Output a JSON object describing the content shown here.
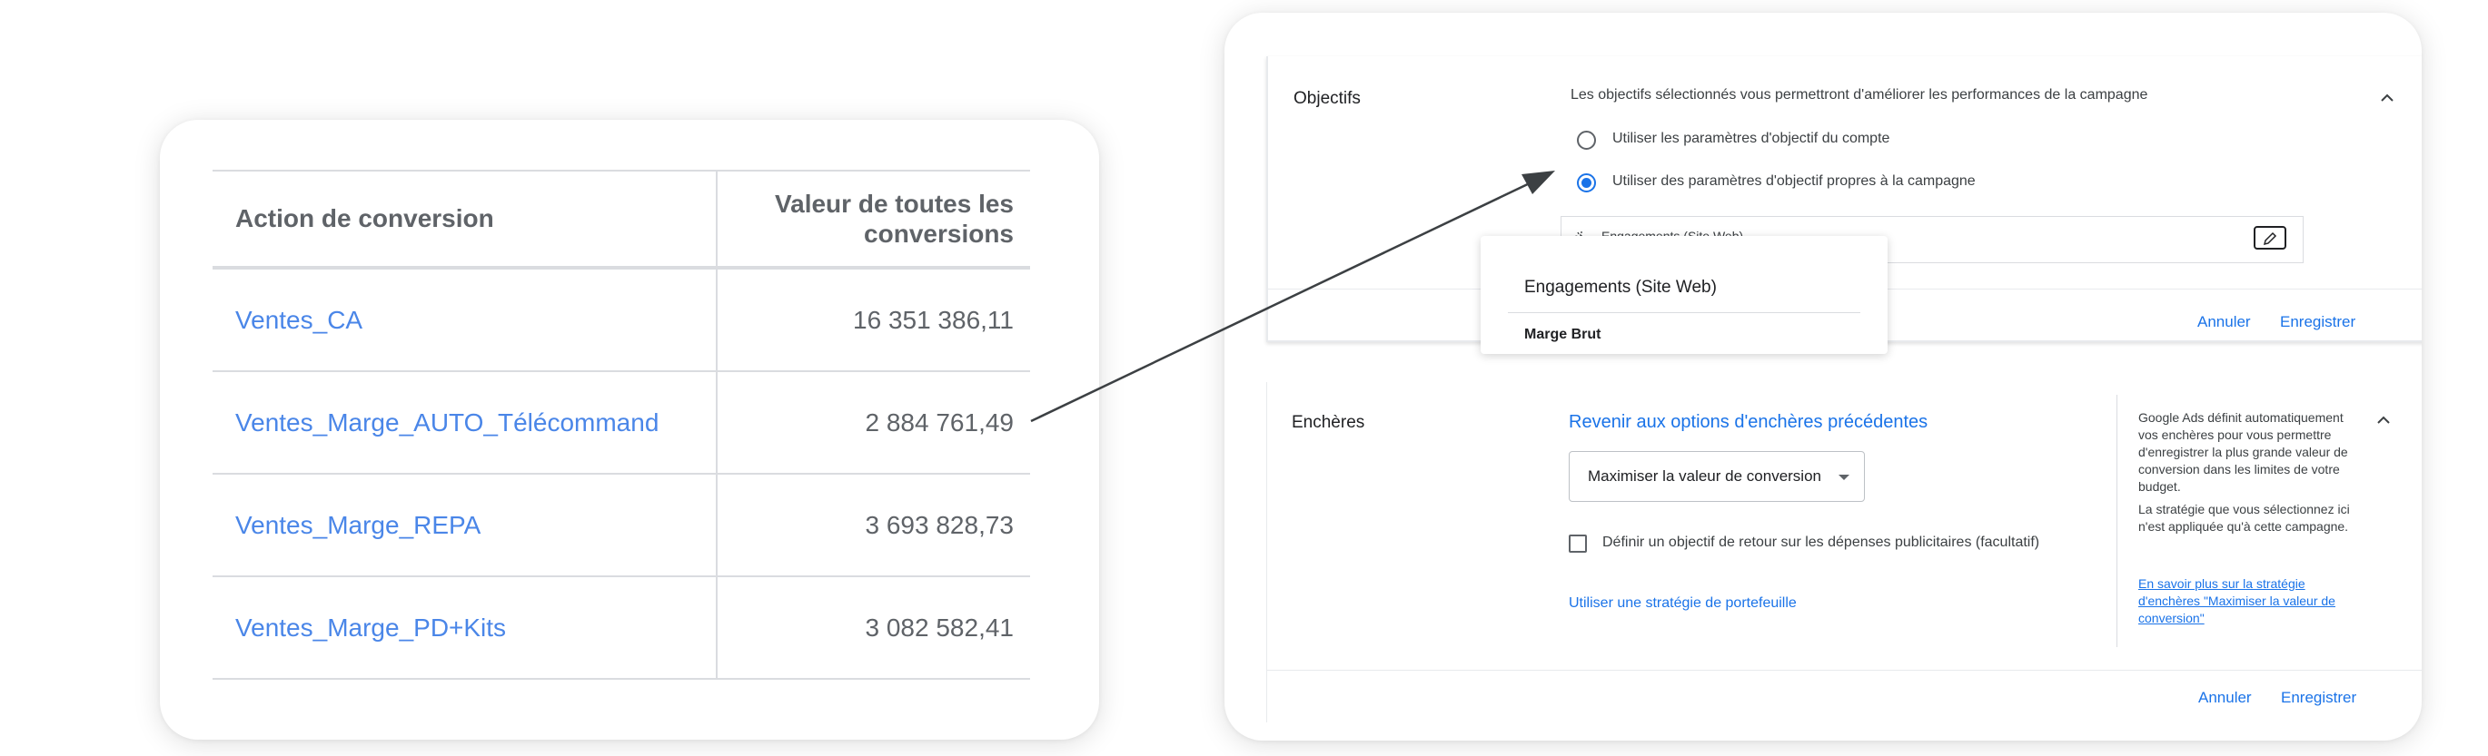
{
  "conversion_table": {
    "header_action": "Action de conversion",
    "header_value": "Valeur de toutes les conversions",
    "rows": [
      {
        "name": "Ventes_CA",
        "value": "16 351 386,11"
      },
      {
        "name": "Ventes_Marge_AUTO_Télécommand",
        "value": "2 884 761,49"
      },
      {
        "name": "Ventes_Marge_REPA",
        "value": "3 693 828,73"
      },
      {
        "name": "Ventes_Marge_PD+Kits",
        "value": "3 082 582,41"
      }
    ]
  },
  "objectives": {
    "title": "Objectifs",
    "description": "Les objectifs sélectionnés vous permettront d'améliorer les performances de la campagne",
    "option_account": "Utiliser les paramètres d'objectif du compte",
    "option_campaign": "Utiliser des paramètres d'objectif propres à la campagne",
    "selected_goal": "Engagements (Site Web)",
    "cancel_label": "Annuler",
    "save_label": "Enregistrer",
    "dropdown": {
      "header": "Engagements (Site Web)",
      "item": "Marge Brut"
    }
  },
  "bidding": {
    "title": "Enchères",
    "revert_link": "Revenir aux options d'enchères précédentes",
    "strategy_select": "Maximiser la valeur de conversion",
    "roas_checkbox_label": "Définir un objectif de retour sur les dépenses publicitaires (facultatif)",
    "portfolio_link": "Utiliser une stratégie de portefeuille",
    "side_text_1": "Google Ads définit automatiquement vos enchères pour vous permettre d'enregistrer la plus grande valeur de conversion dans les limites de votre budget.",
    "side_text_2": "La stratégie que vous sélectionnez ici n'est appliquée qu'à cette campagne.",
    "side_link": "En savoir plus sur la stratégie d'enchères \"Maximiser la valeur de conversion\"",
    "cancel_label": "Annuler",
    "save_label": "Enregistrer"
  },
  "colors": {
    "accent": "#1a73e8",
    "table_link": "#4a86e8",
    "arrow": "#3c4043"
  }
}
